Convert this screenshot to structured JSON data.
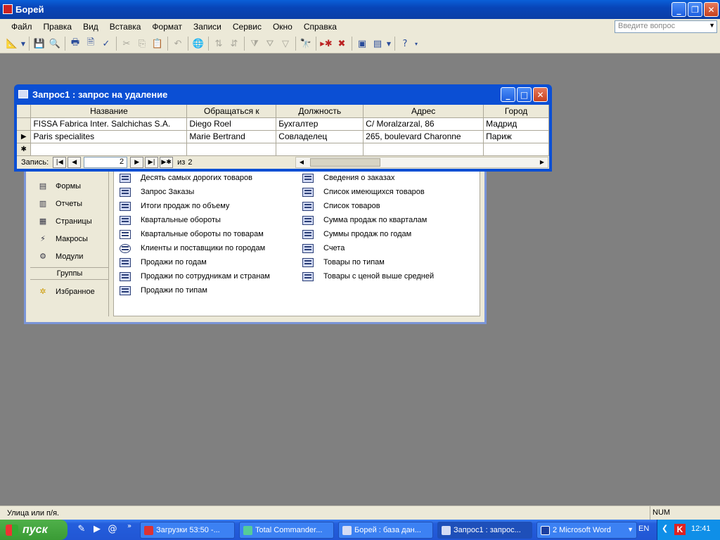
{
  "app": {
    "title": "Борей"
  },
  "menu": {
    "items": [
      "Файл",
      "Правка",
      "Вид",
      "Вставка",
      "Формат",
      "Записи",
      "Сервис",
      "Окно",
      "Справка"
    ],
    "ask_placeholder": "Введите вопрос"
  },
  "db_window": {
    "sidebar": [
      "Формы",
      "Отчеты",
      "Страницы",
      "Макросы",
      "Модули"
    ],
    "groups_label": "Группы",
    "favorites_label": "Избранное",
    "col1": [
      "Десять самых дорогих товаров",
      "Запрос Заказы",
      "Итоги продаж по объему",
      "Квартальные обороты",
      "Квартальные обороты по товарам",
      "Клиенты и поставщики по городам",
      "Продажи по годам",
      "Продажи по сотрудникам и странам",
      "Продажи по типам"
    ],
    "col2": [
      "Сведения о заказах",
      "Список имеющихся товаров",
      "Список товаров",
      "Сумма продаж по кварталам",
      "Суммы продаж по годам",
      "Счета",
      "Товары по типам",
      "Товары с ценой выше средней"
    ]
  },
  "query_window": {
    "title": "Запрос1 : запрос на удаление",
    "columns": [
      "Название",
      "Обращаться к",
      "Должность",
      "Адрес",
      "Город"
    ],
    "rows": [
      [
        "FISSA Fabrica Inter. Salchichas S.A.",
        "Diego Roel",
        "Бухгалтер",
        "C/ Moralzarzal, 86",
        "Мадрид"
      ],
      [
        "Paris specialites",
        "Marie Bertrand",
        "Совладелец",
        "265, boulevard Charonne",
        "Париж"
      ]
    ],
    "nav": {
      "label": "Запись:",
      "current": "2",
      "of_label": "из",
      "total": "2"
    }
  },
  "status": {
    "text": "Улица или п/я.",
    "num": "NUM"
  },
  "taskbar": {
    "start_label": "пуск",
    "tasks": [
      "Загрузки 53:50 -...",
      "Total Commander...",
      "Борей : база дан...",
      "Запрос1 : запрос...",
      "2 Microsoft Word"
    ],
    "lang": "EN",
    "clock": "12:41"
  }
}
